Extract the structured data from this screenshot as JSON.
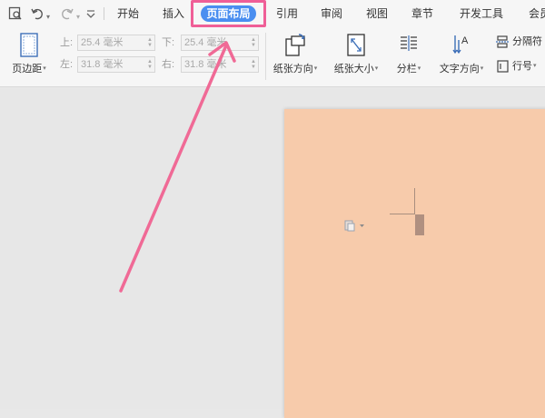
{
  "quick_access": {
    "icons": [
      "print-preview-icon",
      "undo-icon",
      "redo-icon",
      "customize-quick-access-icon"
    ]
  },
  "tabs": [
    {
      "label": "开始"
    },
    {
      "label": "插入"
    },
    {
      "label": "页面布局",
      "active": true
    },
    {
      "label": "引用"
    },
    {
      "label": "审阅"
    },
    {
      "label": "视图"
    },
    {
      "label": "章节"
    },
    {
      "label": "开发工具"
    },
    {
      "label": "会员"
    }
  ],
  "ribbon": {
    "margins_button": "页边距",
    "margin_top_label": "上:",
    "margin_top_value": "25.4 毫米",
    "margin_bottom_label": "下:",
    "margin_bottom_value": "25.4 毫米",
    "margin_left_label": "左:",
    "margin_left_value": "31.8 毫米",
    "margin_right_label": "右:",
    "margin_right_value": "31.8 毫米",
    "orientation_button": "纸张方向",
    "size_button": "纸张大小",
    "columns_button": "分栏",
    "text_direction_button": "文字方向",
    "separator_button": "分隔符",
    "line_number_button": "行号"
  },
  "colors": {
    "active_tab_bg": "#4a8ef0",
    "highlight_box": "#ef5f97",
    "arrow": "#f06a96",
    "page_bg": "#f7cbab"
  }
}
